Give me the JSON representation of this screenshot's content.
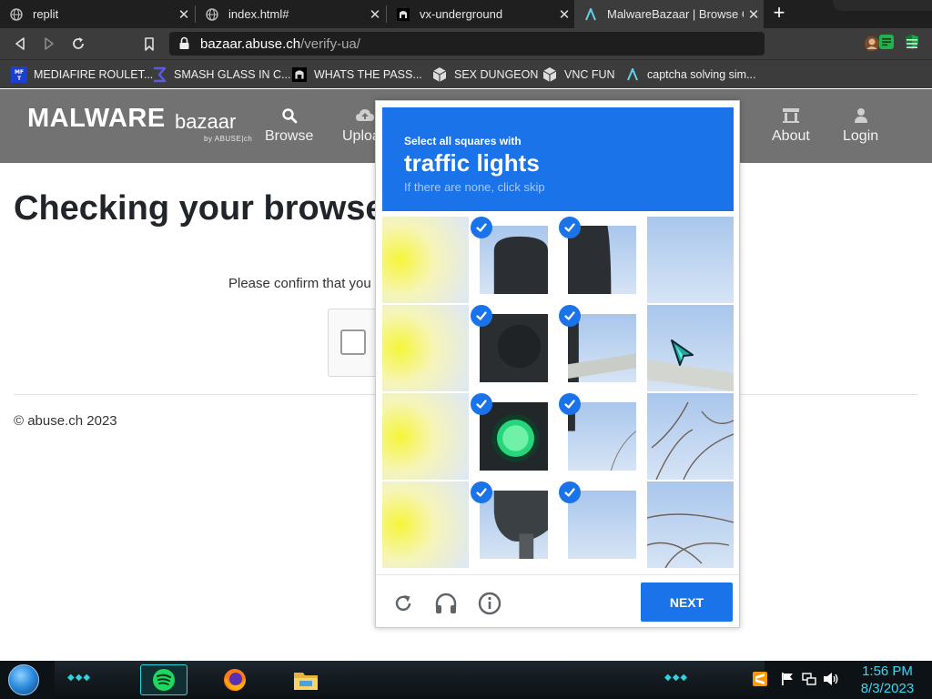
{
  "browser": {
    "tabs": [
      {
        "title": "replit",
        "icon": "globe-icon",
        "active": false
      },
      {
        "title": "index.html#",
        "icon": "globe-icon",
        "active": false
      },
      {
        "title": "vx-underground",
        "icon": "vx-underground-icon",
        "active": false
      },
      {
        "title": "MalwareBazaar | Browse Checkpoint",
        "icon": "malwarebazaar-icon",
        "active": true
      }
    ],
    "close_glyph": "✕",
    "new_tab_glyph": "+",
    "url": {
      "host": "bazaar.abuse.ch",
      "path": "/verify-ua/"
    },
    "bookmarks": [
      {
        "label": "MEDIAFIRE ROULET...",
        "icon": "mediafire-icon"
      },
      {
        "label": "SMASH GLASS IN C...",
        "icon": "sigma-icon"
      },
      {
        "label": "WHATS THE PASS...",
        "icon": "vx-underground-icon"
      },
      {
        "label": "SEX DUNGEON",
        "icon": "cube-icon"
      },
      {
        "label": "VNC FUN",
        "icon": "cube-icon"
      },
      {
        "label": "captcha solving sim...",
        "icon": "malwarebazaar-icon"
      }
    ]
  },
  "site": {
    "logo_main": "MALWARE",
    "logo_sub": "bazaar",
    "logo_by": "by ABUSE|ch",
    "nav": [
      {
        "label": "Browse",
        "icon": "search-icon"
      },
      {
        "label": "Upload",
        "icon": "cloud-upload-icon"
      },
      {
        "label": "About",
        "icon": "bank-icon"
      },
      {
        "label": "Login",
        "icon": "user-icon"
      }
    ],
    "heading": "Checking your browser",
    "confirm_text": "Please confirm that you are human",
    "footer": "© abuse.ch 2023"
  },
  "captcha": {
    "instruction": "Select all squares with",
    "target": "traffic lights",
    "skip_hint": "If there are none, click skip",
    "next_label": "NEXT",
    "selected": [
      [
        false,
        true,
        true,
        false
      ],
      [
        false,
        true,
        true,
        false
      ],
      [
        false,
        true,
        true,
        false
      ],
      [
        false,
        true,
        true,
        false
      ]
    ],
    "tools": [
      "refresh-icon",
      "audio-icon",
      "info-icon"
    ]
  },
  "taskbar": {
    "time": "1:56 PM",
    "date": "8/3/2023",
    "apps": [
      "spotify-icon",
      "firefox-icon",
      "file-explorer-icon"
    ],
    "tray": [
      "sublime-icon",
      "flag-icon",
      "network-icon",
      "volume-icon"
    ]
  },
  "colors": {
    "accent": "#1a73e8",
    "header_gray": "#727272",
    "clock": "#38d9ef"
  }
}
